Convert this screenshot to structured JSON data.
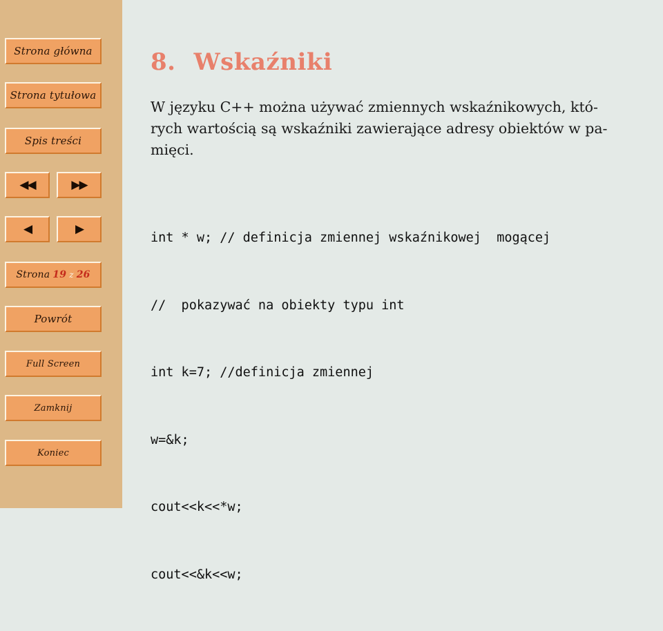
{
  "sidebar": {
    "buttons": [
      {
        "id": "home",
        "label": "Strona główna"
      },
      {
        "id": "title-page",
        "label": "Strona tytułowa"
      },
      {
        "id": "toc",
        "label": "Spis treści"
      },
      {
        "id": "back",
        "label": "Powrót"
      },
      {
        "id": "fullscreen",
        "label": "Full Screen"
      },
      {
        "id": "close",
        "label": "Zamknij"
      },
      {
        "id": "end",
        "label": "Koniec"
      }
    ],
    "nav": {
      "first_icon": "double-left-arrow-icon",
      "last_icon": "double-right-arrow-icon",
      "prev_icon": "left-arrow-icon",
      "next_icon": "right-arrow-icon",
      "first_glyph": "◀◀",
      "last_glyph": "▶▶",
      "prev_glyph": "◀",
      "next_glyph": "▶"
    },
    "page_indicator": {
      "prefix": "Strona",
      "current": "19",
      "separator": "z",
      "total": "26"
    },
    "colors": {
      "background": "#ddb887",
      "button": "#f0a263",
      "button_highlight": "#fdf3e2",
      "button_shadow": "#d07a2e",
      "page_number": "#c42b1c"
    }
  },
  "main": {
    "title": {
      "number": "8.",
      "text": "Wskaźniki",
      "color": "#e8806b"
    },
    "paragraph_lines": [
      "W języku C++ można używać zmiennych wskaźnikowych, któ-",
      "rych wartością są wskaźniki zawierające adresy obiektów w pa-",
      "mięci."
    ],
    "code_lines": [
      "int * w; // definicja zmiennej wskaźnikowej  mogącej",
      "//  pokazywać na obiekty typu int",
      "int k=7; //definicja zmiennej",
      "w=&k;",
      "cout<<k<<*w;",
      "cout<<&k<<w;"
    ],
    "colors": {
      "background": "#e4eae7",
      "text": "#1b1b1b"
    }
  }
}
